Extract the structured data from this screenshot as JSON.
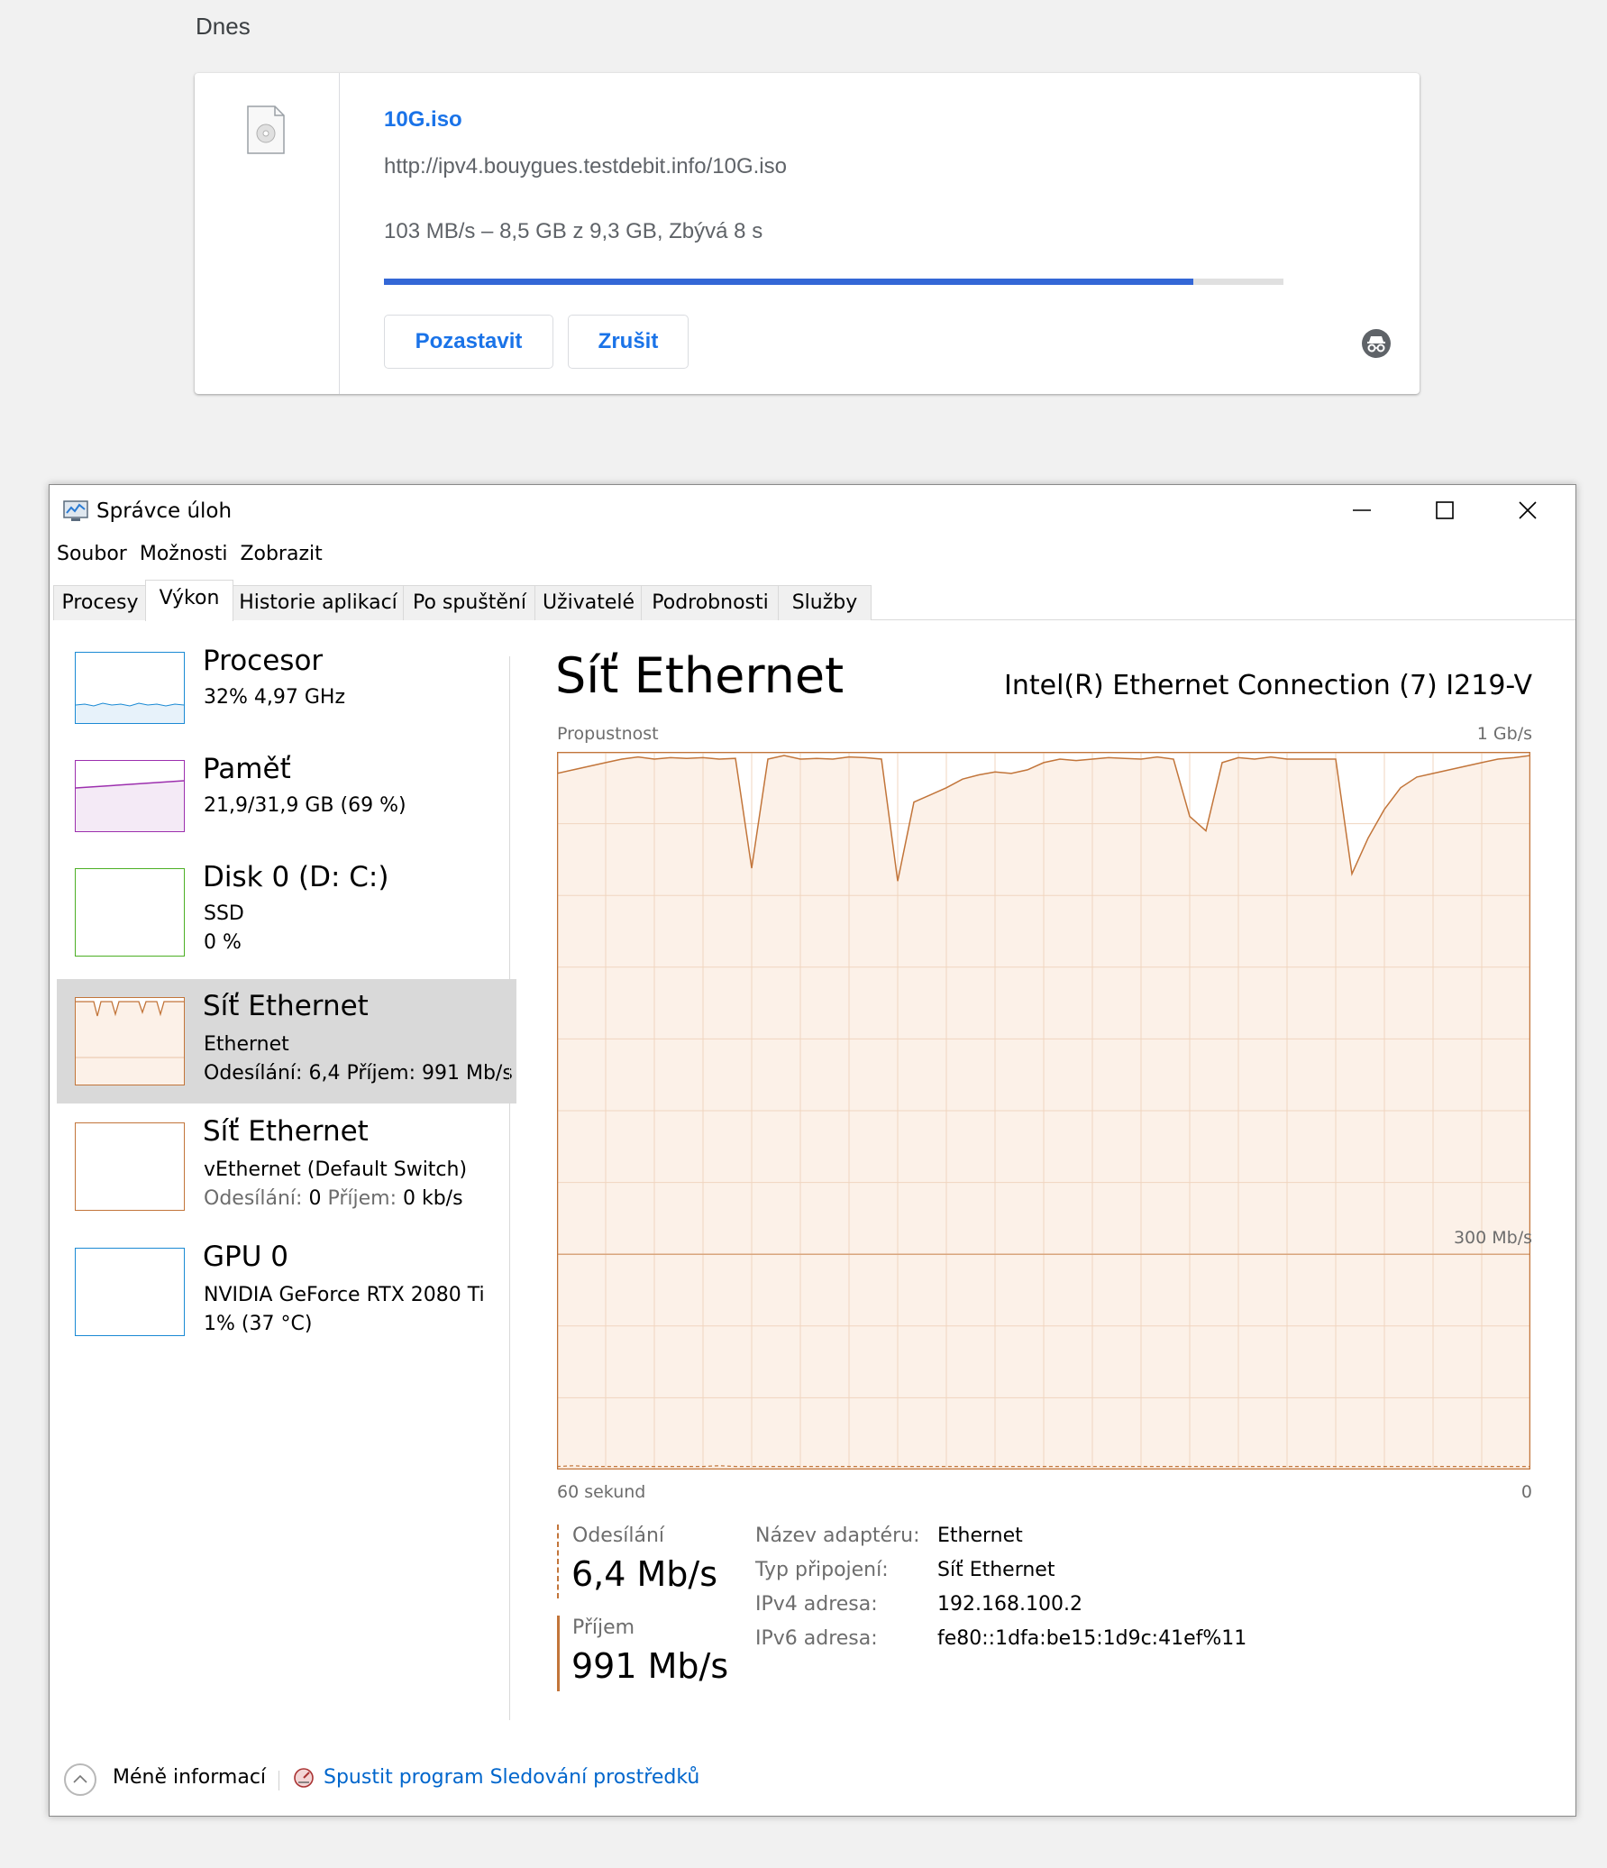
{
  "downloads": {
    "day_label": "Dnes",
    "item": {
      "file_name": "10G.iso",
      "url": "http://ipv4.bouygues.testdebit.info/10G.iso",
      "status": "103 MB/s – 8,5 GB z 9,3 GB, Zbývá 8 s",
      "progress_fraction": 0.9,
      "pause_label": "Pozastavit",
      "cancel_label": "Zrušit",
      "accent_color": "#1a73e8",
      "icons": [
        "file-icon",
        "incognito-icon"
      ]
    }
  },
  "taskmanager": {
    "title": "Správce úloh",
    "menu": [
      "Soubor",
      "Možnosti",
      "Zobrazit"
    ],
    "tabs": [
      "Procesy",
      "Výkon",
      "Historie aplikací",
      "Po spuštění",
      "Uživatelé",
      "Podrobnosti",
      "Služby"
    ],
    "active_tab": "Výkon",
    "sidebar": [
      {
        "title": "Procesor",
        "line1": "32%  4,97 GHz",
        "line2": "",
        "color": "#1a8ad4"
      },
      {
        "title": "Paměť",
        "line1": "21,9/31,9 GB (69 %)",
        "line2": "",
        "color": "#9c2fae"
      },
      {
        "title": "Disk 0 (D: C:)",
        "line1": "SSD",
        "line2": "0 %",
        "color": "#4caf24"
      },
      {
        "title": "Síť Ethernet",
        "line1": "Ethernet",
        "line2_send_label": "Odesílání:",
        "line2_send_value": "6,4",
        "line2_recv_label": "Příjem:",
        "line2_recv_value": "991 Mb/s",
        "color": "#c2753a"
      },
      {
        "title": "Síť Ethernet",
        "line1": "vEthernet (Default Switch)",
        "line2_send_label": "Odesílání:",
        "line2_send_value": "0",
        "line2_recv_label": "Příjem:",
        "line2_recv_value": "0 kb/s",
        "color": "#c2753a"
      },
      {
        "title": "GPU 0",
        "line1": "NVIDIA GeForce RTX 2080 Ti",
        "line2": "1%  (37 °C)",
        "color": "#1a8ad4"
      }
    ],
    "main": {
      "title": "Síť Ethernet",
      "adapter": "Intel(R) Ethernet Connection (7) I219-V",
      "throughput_label": "Propustnost",
      "max_label": "1 Gb/s",
      "mid_label": "300 Mb/s",
      "time_label": "60 sekund",
      "zero_label": "0",
      "send_label": "Odesílání",
      "send_value": "6,4 Mb/s",
      "recv_label": "Příjem",
      "recv_value": "991 Mb/s",
      "props": [
        {
          "k": "Název adaptéru:",
          "v": "Ethernet"
        },
        {
          "k": "Typ připojení:",
          "v": "Síť Ethernet"
        },
        {
          "k": "IPv4 adresa:",
          "v": "192.168.100.2"
        },
        {
          "k": "IPv6 adresa:",
          "v": "fe80::1dfa:be15:1d9c:41ef%11"
        }
      ]
    },
    "footer": {
      "less_label": "Méně informací",
      "resmon_label": "Spustit program Sledování prostředků"
    }
  },
  "chart_data": {
    "type": "area",
    "xlabel": "60 sekund",
    "ylabel": "Propustnost",
    "ylim": [
      0,
      1000
    ],
    "y_unit": "Mb/s",
    "x": [
      0,
      1,
      2,
      3,
      4,
      5,
      6,
      7,
      8,
      9,
      10,
      11,
      12,
      13,
      14,
      15,
      16,
      17,
      18,
      19,
      20,
      21,
      22,
      23,
      24,
      25,
      26,
      27,
      28,
      29,
      30,
      31,
      32,
      33,
      34,
      35,
      36,
      37,
      38,
      39,
      40,
      41,
      42,
      43,
      44,
      45,
      46,
      47,
      48,
      49,
      50,
      51,
      52,
      53,
      54,
      55,
      56,
      57,
      58,
      59,
      60
    ],
    "series": [
      {
        "values": [
          970,
          975,
          980,
          985,
          990,
          993,
          990,
          992,
          991,
          992,
          990,
          991,
          838,
          990,
          995,
          990,
          991,
          990,
          993,
          992,
          990,
          820,
          930,
          940,
          950,
          962,
          968,
          972,
          970,
          975,
          985,
          990,
          988,
          990,
          992,
          991,
          990,
          993,
          990,
          910,
          890,
          985,
          992,
          990,
          993,
          990,
          990,
          990,
          990,
          830,
          880,
          920,
          950,
          965,
          970,
          975,
          980,
          985,
          990,
          992,
          995
        ]
      },
      {
        "values": [
          3,
          4,
          3,
          3,
          3,
          3,
          3,
          3,
          3,
          3,
          4,
          3,
          3,
          3,
          3,
          3,
          3,
          3,
          3,
          3,
          3,
          3,
          3,
          3,
          3,
          3,
          3,
          3,
          3,
          3,
          3,
          3,
          3,
          3,
          3,
          3,
          3,
          3,
          3,
          3,
          3,
          3,
          3,
          3,
          3,
          3,
          3,
          3,
          3,
          3,
          3,
          3,
          3,
          3,
          3,
          3,
          3,
          3,
          3,
          3,
          3
        ]
      }
    ]
  }
}
